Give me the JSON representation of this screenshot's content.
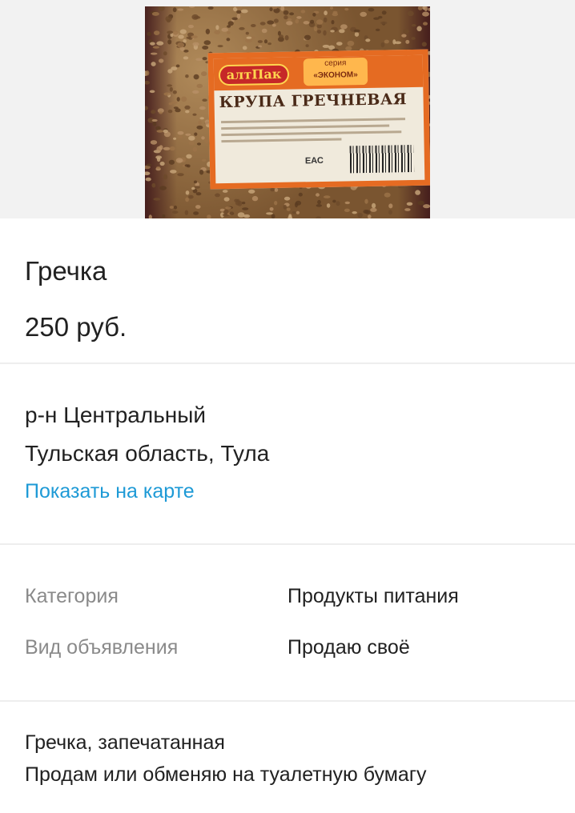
{
  "listing": {
    "photo": {
      "icon": "buckwheat-package-photo",
      "package_brand": "алтПак",
      "package_series_top": "серия",
      "package_series_name": "«ЭКОНОМ»",
      "package_title": "КРУПА ГРЕЧНЕВАЯ",
      "package_mark": "ЕАС"
    },
    "title": "Гречка",
    "price": "250 руб."
  },
  "location": {
    "district": "р-н Центральный",
    "city": "Тульская область, Тула",
    "map_link": "Показать на карте",
    "link_color": "#1e9ad6"
  },
  "params": [
    {
      "label": "Категория",
      "value": "Продукты питания"
    },
    {
      "label": "Вид объявления",
      "value": "Продаю своё"
    }
  ],
  "description": {
    "line1": "Гречка, запечатанная",
    "line2": "Продам или обменяю на туалетную бумагу"
  }
}
